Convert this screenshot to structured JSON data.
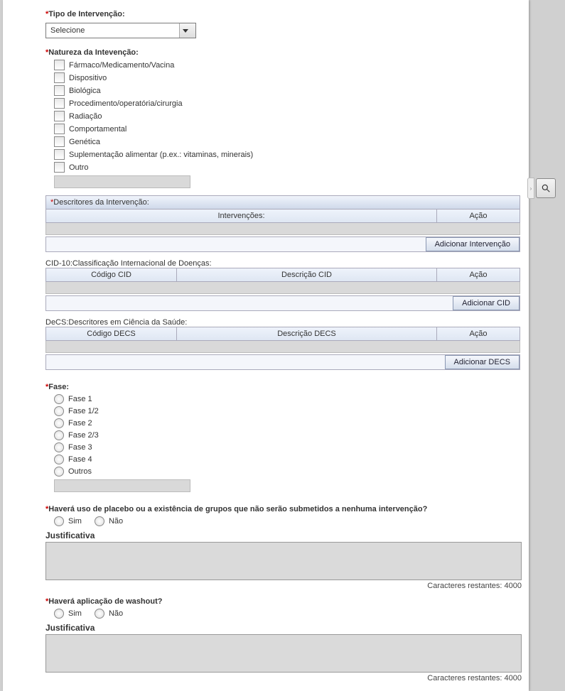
{
  "tipo": {
    "label": "Tipo de Intervenção:",
    "value": "Selecione"
  },
  "natureza": {
    "label": "Natureza da Intevenção:",
    "options": [
      "Fármaco/Medicamento/Vacina",
      "Dispositivo",
      "Biológica",
      "Procedimento/operatória/cirurgia",
      "Radiação",
      "Comportamental",
      "Genética",
      "Suplementação alimentar (p.ex.: vitaminas, minerais)",
      "Outro"
    ]
  },
  "descritores": {
    "title": "Descritores da Intervenção:",
    "col_intervencoes": "Intervenções:",
    "col_acao": "Ação",
    "btn_add": "Adicionar Intervenção"
  },
  "cid": {
    "title": "CID-10:Classificação Internacional de Doenças:",
    "col_codigo": "Código CID",
    "col_desc": "Descrição CID",
    "col_acao": "Ação",
    "btn_add": "Adicionar CID"
  },
  "decs": {
    "title": "DeCS:Descritores em Ciência da Saúde:",
    "col_codigo": "Código DECS",
    "col_desc": "Descrição DECS",
    "col_acao": "Ação",
    "btn_add": "Adicionar DECS"
  },
  "fase": {
    "label": "Fase:",
    "options": [
      "Fase 1",
      "Fase 1/2",
      "Fase 2",
      "Fase 2/3",
      "Fase 3",
      "Fase 4",
      "Outros"
    ]
  },
  "placebo": {
    "label": "Haverá uso de placebo ou a existência de grupos que não serão submetidos a nenhuma intervenção?",
    "sim": "Sim",
    "nao": "Não"
  },
  "washout": {
    "label": "Haverá aplicação de washout?",
    "sim": "Sim",
    "nao": "Não"
  },
  "justificativa_label": "Justificativa",
  "counter": {
    "prefix": "Caracteres restantes:",
    "value": "4000"
  }
}
